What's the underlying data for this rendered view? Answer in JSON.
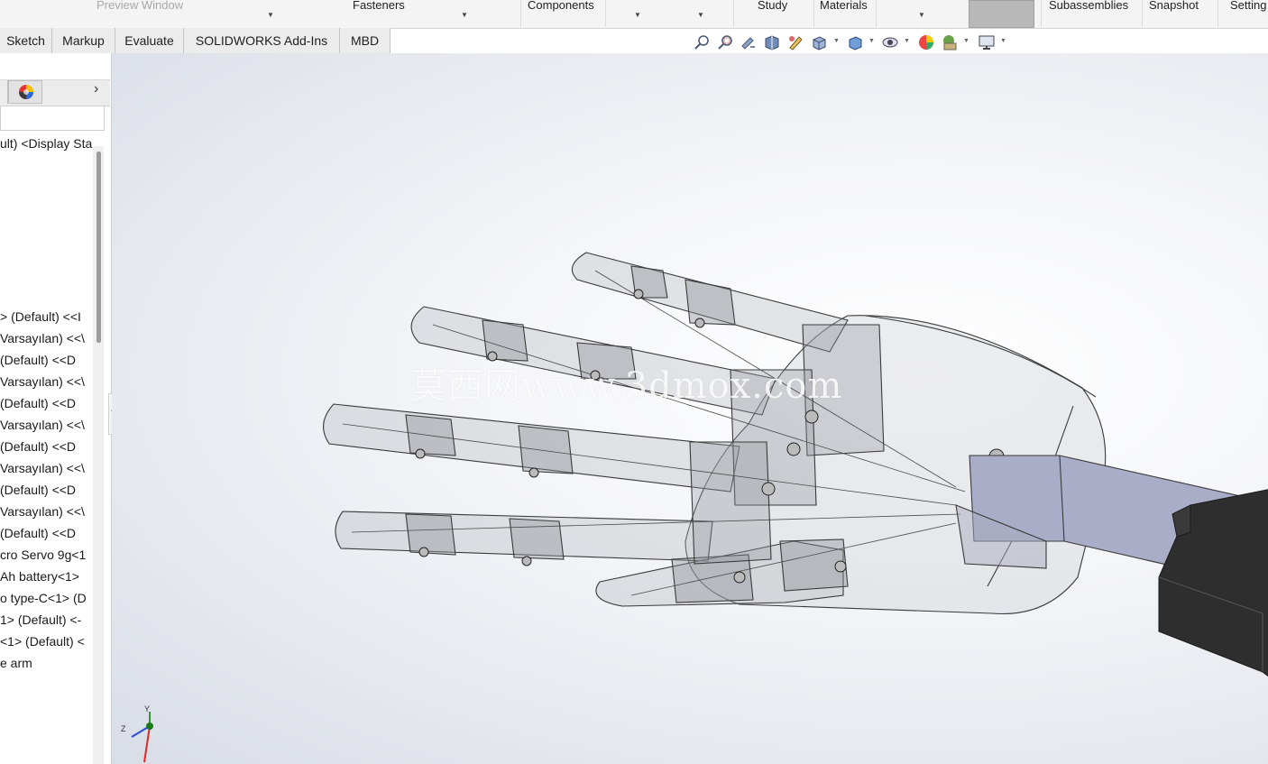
{
  "ribbon": {
    "items": [
      {
        "label": "Preview Window",
        "dim": true
      },
      {
        "label": "Fasteners"
      },
      {
        "label": "Components"
      },
      {
        "label": "Study"
      },
      {
        "label": "Materials"
      },
      {
        "label": "Subassemblies"
      },
      {
        "label": "Snapshot"
      },
      {
        "label": "Setting"
      }
    ]
  },
  "tabs": [
    "Sketch",
    "Markup",
    "Evaluate",
    "SOLIDWORKS Add-Ins",
    "MBD"
  ],
  "heads_up_icons": [
    "zoom-to-fit-icon",
    "zoom-to-area-icon",
    "previous-view-icon",
    "section-view-icon",
    "dynamic-annotation-icon",
    "view-orientation-icon",
    "display-style-icon",
    "hide-show-items-icon",
    "edit-appearance-icon",
    "apply-scene-icon",
    "view-settings-icon"
  ],
  "feature_tree": {
    "root": "ult) <Display Sta",
    "items": [
      "> (Default) <<I",
      "Varsayılan) <<\\",
      " (Default) <<D",
      "Varsayılan) <<\\",
      " (Default) <<D",
      "Varsayılan) <<\\",
      " (Default) <<D",
      "Varsayılan) <<\\",
      " (Default) <<D",
      "Varsayılan) <<\\",
      " (Default) <<D",
      "cro Servo 9g<1",
      "Ah battery<1>",
      "o type-C<1> (D",
      "1> (Default) <-",
      "<1> (Default) <",
      "e arm"
    ]
  },
  "watermark": "莫西网www.3dmox.com",
  "triad": {
    "y": "Y",
    "z": "Z"
  },
  "colors": {
    "accent_tab_bg": "#ececec",
    "model_edge": "#3a3a3a",
    "servo_body": "#2e2e2e",
    "forearm_block": "#9aa0bd"
  }
}
